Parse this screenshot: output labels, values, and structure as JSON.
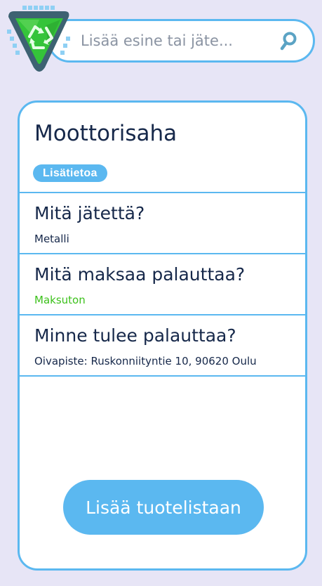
{
  "search": {
    "placeholder": "Lisää esine tai jäte..."
  },
  "icons": {
    "logo": "recycle-shield-logo",
    "search": "search-icon"
  },
  "colors": {
    "background": "#e7e5f6",
    "accent": "#5bb8f0",
    "logo_frame": "#3d6272",
    "logo_green": "#35c43a",
    "free_text": "#3cc11b",
    "text_dark": "#16284a"
  },
  "product": {
    "title": "Moottorisaha",
    "info_badge": "Lisätietoa"
  },
  "sections": [
    {
      "question": "Mitä jätettä?",
      "answer": "Metalli"
    },
    {
      "question": "Mitä maksaa palauttaa?",
      "answer": "Maksuton"
    },
    {
      "question": "Minne tulee palauttaa?",
      "answer": "Oivapiste: Ruskonniityntie 10, 90620 Oulu"
    }
  ],
  "actions": {
    "add_to_list": "Lisää tuotelistaan"
  }
}
